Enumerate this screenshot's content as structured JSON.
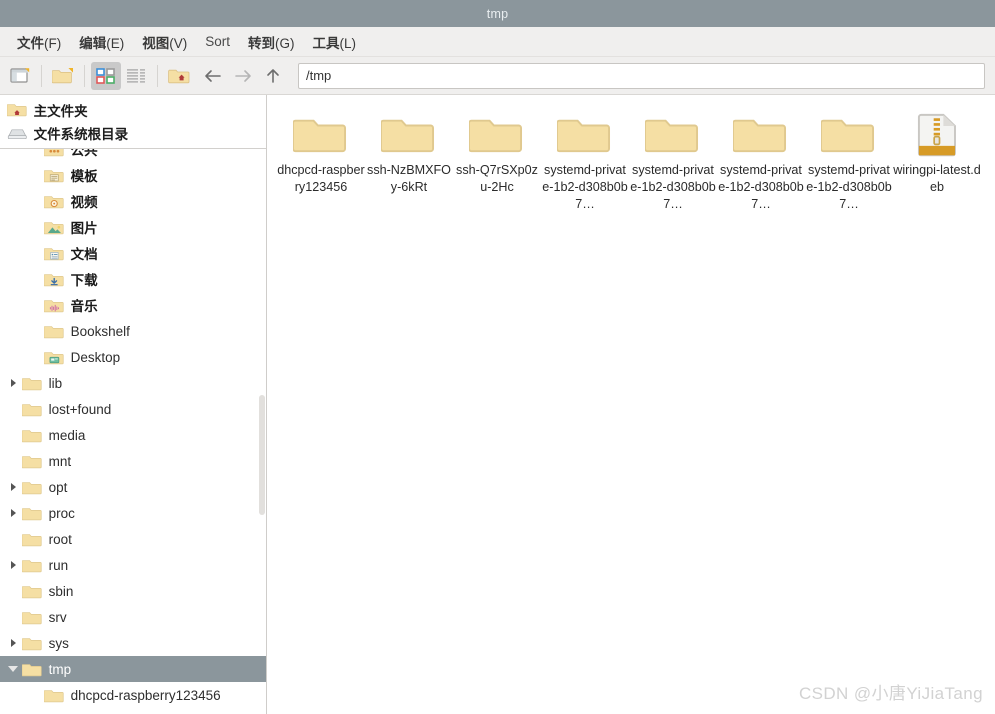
{
  "window": {
    "title": "tmp"
  },
  "menubar": {
    "items": [
      {
        "name": "menu-file",
        "text": "文件",
        "mnemonic": "(F)",
        "cjk": true
      },
      {
        "name": "menu-edit",
        "text": "编辑",
        "mnemonic": "(E)",
        "cjk": true
      },
      {
        "name": "menu-view",
        "text": "视图",
        "mnemonic": "(V)",
        "cjk": true
      },
      {
        "name": "menu-sort",
        "text": "Sort",
        "mnemonic": "",
        "cjk": false
      },
      {
        "name": "menu-go",
        "text": "转到",
        "mnemonic": "(G)",
        "cjk": true
      },
      {
        "name": "menu-tools",
        "text": "工具",
        "mnemonic": "(L)",
        "cjk": true
      }
    ]
  },
  "toolbar": {
    "buttons": [
      {
        "name": "new-window-button",
        "icon": "new-window-icon",
        "active": false
      },
      {
        "name": "new-folder-button",
        "icon": "new-folder-icon",
        "active": false
      },
      {
        "name": "icon-view-button",
        "icon": "icon-view-icon",
        "active": true
      },
      {
        "name": "list-view-button",
        "icon": "list-view-icon",
        "active": false
      },
      {
        "name": "home-button",
        "icon": "home-folder-icon",
        "active": false
      },
      {
        "name": "back-button",
        "icon": "arrow-left-icon",
        "active": false
      },
      {
        "name": "forward-button",
        "icon": "arrow-right-icon",
        "active": false
      },
      {
        "name": "up-button",
        "icon": "arrow-up-icon",
        "active": false
      }
    ],
    "path": {
      "value": "/tmp",
      "placeholder": "Path"
    }
  },
  "sidebar": {
    "places": [
      {
        "name": "place-home",
        "label": "主文件夹",
        "icon": "home-folder-icon"
      },
      {
        "name": "place-filesystem",
        "label": "文件系统根目录",
        "icon": "drive-icon"
      }
    ],
    "tree": [
      {
        "name": "tree-item-public",
        "label": "公共",
        "icon": "folder-public-icon",
        "indent": 2,
        "twisty": "none",
        "cjk": true,
        "selected": false
      },
      {
        "name": "tree-item-templates",
        "label": "模板",
        "icon": "folder-template-icon",
        "indent": 2,
        "twisty": "none",
        "cjk": true,
        "selected": false
      },
      {
        "name": "tree-item-videos",
        "label": "视频",
        "icon": "folder-video-icon",
        "indent": 2,
        "twisty": "none",
        "cjk": true,
        "selected": false
      },
      {
        "name": "tree-item-pictures",
        "label": "图片",
        "icon": "folder-pictures-icon",
        "indent": 2,
        "twisty": "none",
        "cjk": true,
        "selected": false
      },
      {
        "name": "tree-item-documents",
        "label": "文档",
        "icon": "folder-documents-icon",
        "indent": 2,
        "twisty": "none",
        "cjk": true,
        "selected": false
      },
      {
        "name": "tree-item-downloads",
        "label": "下载",
        "icon": "folder-download-icon",
        "indent": 2,
        "twisty": "none",
        "cjk": true,
        "selected": false
      },
      {
        "name": "tree-item-music",
        "label": "音乐",
        "icon": "folder-music-icon",
        "indent": 2,
        "twisty": "none",
        "cjk": true,
        "selected": false
      },
      {
        "name": "tree-item-bookshelf",
        "label": "Bookshelf",
        "icon": "folder-icon",
        "indent": 2,
        "twisty": "none",
        "cjk": false,
        "selected": false
      },
      {
        "name": "tree-item-desktop",
        "label": "Desktop",
        "icon": "folder-desktop-icon",
        "indent": 2,
        "twisty": "none",
        "cjk": false,
        "selected": false
      },
      {
        "name": "tree-item-lib",
        "label": "lib",
        "icon": "folder-icon",
        "indent": 1,
        "twisty": "closed",
        "cjk": false,
        "selected": false
      },
      {
        "name": "tree-item-lost-found",
        "label": "lost+found",
        "icon": "folder-icon",
        "indent": 1,
        "twisty": "none",
        "cjk": false,
        "selected": false
      },
      {
        "name": "tree-item-media",
        "label": "media",
        "icon": "folder-icon",
        "indent": 1,
        "twisty": "none",
        "cjk": false,
        "selected": false
      },
      {
        "name": "tree-item-mnt",
        "label": "mnt",
        "icon": "folder-icon",
        "indent": 1,
        "twisty": "none",
        "cjk": false,
        "selected": false
      },
      {
        "name": "tree-item-opt",
        "label": "opt",
        "icon": "folder-icon",
        "indent": 1,
        "twisty": "closed",
        "cjk": false,
        "selected": false
      },
      {
        "name": "tree-item-proc",
        "label": "proc",
        "icon": "folder-icon",
        "indent": 1,
        "twisty": "closed",
        "cjk": false,
        "selected": false
      },
      {
        "name": "tree-item-root",
        "label": "root",
        "icon": "folder-icon",
        "indent": 1,
        "twisty": "none",
        "cjk": false,
        "selected": false
      },
      {
        "name": "tree-item-run",
        "label": "run",
        "icon": "folder-icon",
        "indent": 1,
        "twisty": "closed",
        "cjk": false,
        "selected": false
      },
      {
        "name": "tree-item-sbin",
        "label": "sbin",
        "icon": "folder-icon",
        "indent": 1,
        "twisty": "none",
        "cjk": false,
        "selected": false
      },
      {
        "name": "tree-item-srv",
        "label": "srv",
        "icon": "folder-icon",
        "indent": 1,
        "twisty": "none",
        "cjk": false,
        "selected": false
      },
      {
        "name": "tree-item-sys",
        "label": "sys",
        "icon": "folder-icon",
        "indent": 1,
        "twisty": "closed",
        "cjk": false,
        "selected": false
      },
      {
        "name": "tree-item-tmp",
        "label": "tmp",
        "icon": "folder-icon",
        "indent": 1,
        "twisty": "open",
        "cjk": false,
        "selected": true
      },
      {
        "name": "tree-item-dhcpcd-raspberry123456",
        "label": "dhcpcd-raspberry123456",
        "icon": "folder-icon",
        "indent": 2,
        "twisty": "none",
        "cjk": false,
        "selected": false
      }
    ]
  },
  "files": {
    "items": [
      {
        "name": "file-item-dhcpcd-raspberry123456",
        "label": "dhcpcd-raspberry123456",
        "icon": "folder-icon"
      },
      {
        "name": "file-item-ssh-nzbmxfoy6krt",
        "label": "ssh-NzBMXFOy-6kRt",
        "icon": "folder-icon"
      },
      {
        "name": "file-item-ssh-q7rsxp0zu2hc",
        "label": "ssh-Q7rSXp0zu-2Hc",
        "icon": "folder-icon"
      },
      {
        "name": "file-item-systemd-private-1",
        "label": "systemd-private-1b2-d308b0b7…",
        "icon": "folder-icon"
      },
      {
        "name": "file-item-systemd-private-2",
        "label": "systemd-private-1b2-d308b0b7…",
        "icon": "folder-icon"
      },
      {
        "name": "file-item-systemd-private-3",
        "label": "systemd-private-1b2-d308b0b7…",
        "icon": "folder-icon"
      },
      {
        "name": "file-item-systemd-private-4",
        "label": "systemd-private-1b2-d308b0b7…",
        "icon": "folder-icon"
      },
      {
        "name": "file-item-wiringpi-latest-deb",
        "label": "wiringpi-latest.deb",
        "icon": "archive-icon"
      }
    ]
  },
  "watermark": {
    "text": "CSDN @小唐YiJiaTang"
  },
  "colors": {
    "titlebar": "#8b969c",
    "chrome": "#f0efee",
    "selection": "#8b969c",
    "folder": "#f3dca0",
    "accent_orange": "#d79b26"
  }
}
